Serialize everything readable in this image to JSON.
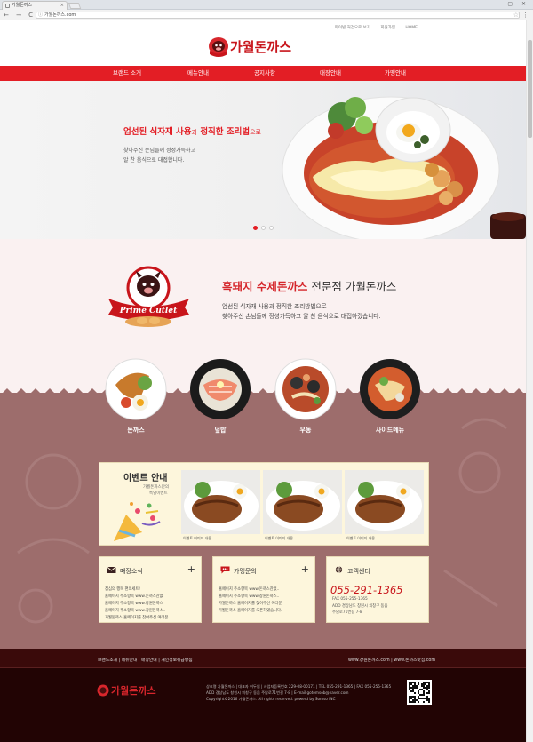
{
  "browser": {
    "tab_title": "가월돈까스",
    "url": "가월돈까스.com",
    "tab_close": "×",
    "window_buttons": "— ▢ ✕",
    "nav_icons": "← → C ⌂",
    "menu_icon": "⋮",
    "star_icon": "☆"
  },
  "header": {
    "links": [
      "마이빌 처건으로 보기",
      "회원가입",
      "HOME"
    ],
    "logo_text": "가월돈까스"
  },
  "nav": {
    "items": [
      "브랜드 소개",
      "메뉴안내",
      "공지사항",
      "매장안내",
      "가맹안내"
    ]
  },
  "hero": {
    "title_a": "엄선된 식자재 사용",
    "title_b": "과",
    "title_c": "정직한 조리법",
    "title_d": "으로",
    "sub1": "찾아주신 손님들께 정성가득하고",
    "sub2": "알 찬 음식으로 대접합니다."
  },
  "intro": {
    "title_hl": "흑돼지 수제돈까스",
    "title_rest": "전문점 가월돈까스",
    "line1": "엄선된 식자재 사용과 정직한 조리방법으로",
    "line2": "찾아주신 손님들께 정성가득하고 알 찬 음식으로 대접하겠습니다.",
    "badge_text": "Prime Cutlet"
  },
  "menu": {
    "categories": [
      "돈까스",
      "덮밥",
      "우동",
      "사이드메뉴"
    ]
  },
  "event": {
    "title": "이벤트 안내",
    "sub1": "가월돈까스만의",
    "sub2": "특별이벤트",
    "captions": [
      "이벤트 이미지 내용",
      "이벤트 이미지 내용",
      "이벤트 이미지 내용"
    ]
  },
  "boxes": {
    "store": {
      "title": "매장소식",
      "plus": "+",
      "lines": [
        "점심의 행복 편의세트!",
        "홈페이지 주소항목 www.돈까스찬없",
        "홈페이지 주소항목 www.창원돈까스",
        "홈페이지 주소항목 www.창원돈까스..",
        "가월돈까스 홈페이지를 찾아주신 여러분"
      ]
    },
    "franchise": {
      "title": "가맹문의",
      "plus": "+",
      "lines": [
        "홈페이지 주소항목 www.돈까스찬없..",
        "홈페이지 주소항목 www.창원돈까스..",
        "가월돈까스 홈페이지를 찾아주신 여러분",
        "가월돈까스 홈페이지를 오픈하였습니다."
      ]
    },
    "customer": {
      "title": "고객센터",
      "phone": "055-291-1365",
      "fax": "FAX 055-255-1365",
      "addr1": "ADD 경상남도 창원시 의창구 동읍",
      "addr2": "주남로71번길 7-8"
    }
  },
  "footer": {
    "links_left": "브랜드소개  |  메뉴안내  |  매장안내  |  개인정보취급방침",
    "links_right": "www.창원돈까스.com  |  www.돈까스맛집.com",
    "logo_text": "가월돈까스",
    "info1": "상호명 가월돈까스 | 대표자 이두임 | 사업자등록번호 229-08-00171 | TEL 055-291-1365 | FAX 055-255-1365",
    "info2": "ADD 경상남도 창원시 의창구 동읍 주남로71번길 7-8 | E-mail gotemsob@naver.com",
    "info3": "Copyright©2016 가월돈까스. All rights reserved. powerd by Somso INC"
  },
  "colors": {
    "accent": "#e31e25",
    "brown": "#9d6d6c",
    "cream": "#fdf6dc",
    "footer": "#220404"
  }
}
